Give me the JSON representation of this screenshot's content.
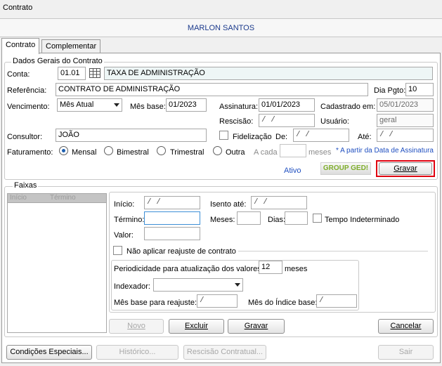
{
  "window": {
    "title": "Contrato"
  },
  "client_name": "MARLON SANTOS",
  "tabs": [
    {
      "label": "Contrato",
      "active": true
    },
    {
      "label": "Complementar",
      "active": false
    }
  ],
  "dados_gerais": {
    "title": "Dados Gerais do Contrato",
    "conta_label": "Conta:",
    "conta_code": "01.01",
    "conta_desc": "TAXA DE ADMINISTRAÇÃO",
    "referencia_label": "Referência:",
    "referencia_value": "CONTRATO DE ADMINISTRAÇÃO",
    "dia_pgto_label": "Dia Pgto:",
    "dia_pgto_value": "10",
    "vencimento_label": "Vencimento:",
    "vencimento_value": "Mês Atual",
    "mes_base_label": "Mês base:",
    "mes_base_value": "01/2023",
    "assinatura_label": "Assinatura:",
    "assinatura_value": "01/01/2023",
    "cadastrado_label": "Cadastrado em:",
    "cadastrado_value": "05/01/2023",
    "rescisao_label": "Rescisão:",
    "rescisao_value": " / /",
    "usuario_label": "Usuário:",
    "usuario_value": "geral",
    "consultor_label": "Consultor:",
    "consultor_value": "JOÃO",
    "fidelizacao_label": "Fidelização",
    "de_label": "De:",
    "de_value": " / /",
    "ate_label": "Até:",
    "ate_value": " / /",
    "faturamento_label": "Faturamento:",
    "faturamento_options": [
      "Mensal",
      "Bimestral",
      "Trimestral",
      "Outra"
    ],
    "faturamento_selected": "Mensal",
    "a_cada_label": "A cada",
    "meses_label": "meses",
    "assinatura_note": "* A partir da Data de Assinatura",
    "status": "Ativo",
    "logo_text": "GROUP GED!",
    "gravar_label": "Gravar"
  },
  "faixas": {
    "title": "Faixas",
    "list_headers": [
      "Início",
      "Término"
    ],
    "inicio_label": "Início:",
    "inicio_value": " / /",
    "isento_label": "Isento até:",
    "isento_value": " / /",
    "termino_label": "Término:",
    "meses_label": "Meses:",
    "dias_label": "Dias:",
    "tempo_label": "Tempo Indeterminado",
    "valor_label": "Valor:",
    "reajuste_label": "Não aplicar reajuste de contrato",
    "periodicidade_label": "Periodicidade para atualização dos valores:",
    "periodicidade_value": "12",
    "periodicidade_unit": "meses",
    "indexador_label": "Indexador:",
    "mes_base_reajuste_label": "Mês base para reajuste:",
    "mes_base_reajuste_value": " /",
    "mes_indice_label": "Mês do Índice base:",
    "mes_indice_value": " /",
    "buttons": {
      "novo": "Novo",
      "excluir": "Excluir",
      "gravar": "Gravar",
      "cancelar": "Cancelar"
    }
  },
  "footer": {
    "condicoes": "Condições Especiais...",
    "historico": "Histórico...",
    "rescisao": "Rescisão Contratual...",
    "sair": "Sair"
  },
  "colors": {
    "client_name": "#1b3a8c",
    "note": "#1f4fc0",
    "highlight": "#e0000f"
  }
}
